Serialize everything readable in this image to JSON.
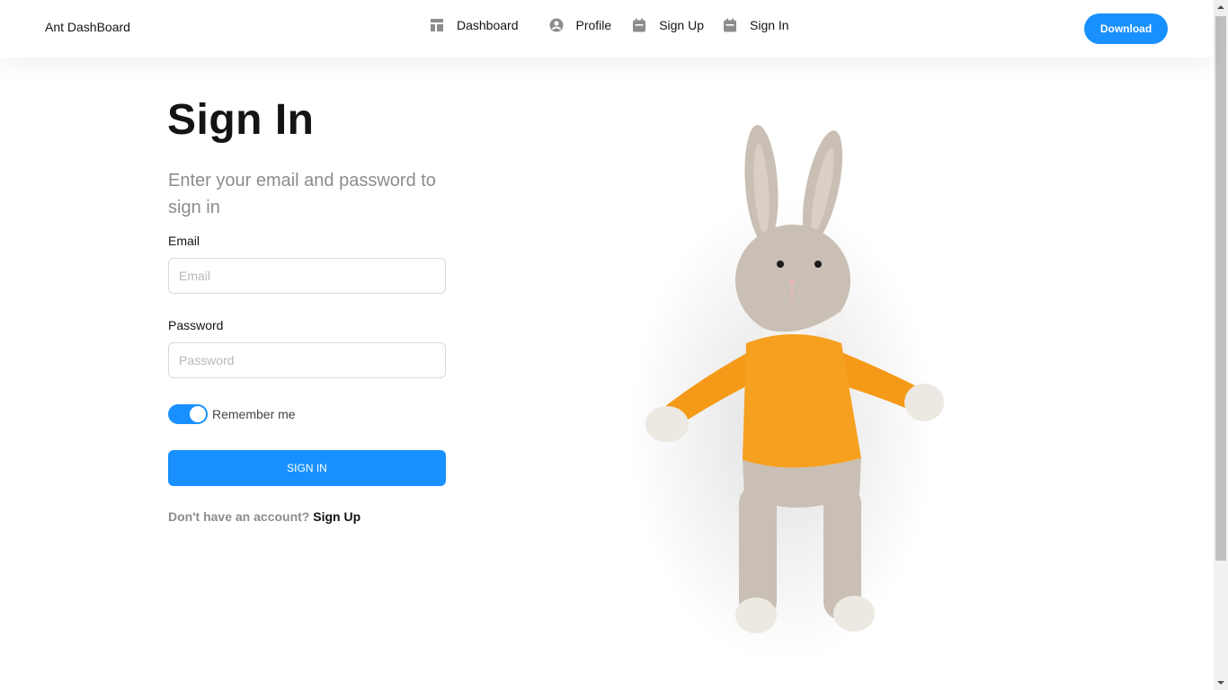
{
  "header": {
    "brand": "Ant DashBoard",
    "nav": [
      {
        "label": "Dashboard",
        "icon": "dashboard-icon"
      },
      {
        "label": "Profile",
        "icon": "user-circle-icon"
      },
      {
        "label": "Sign Up",
        "icon": "calendar-icon"
      },
      {
        "label": "Sign In",
        "icon": "calendar-icon"
      }
    ],
    "download_label": "Download"
  },
  "form": {
    "title": "Sign In",
    "subtitle": "Enter your email and password to sign in",
    "email_label": "Email",
    "email_placeholder": "Email",
    "email_value": "",
    "password_label": "Password",
    "password_placeholder": "Password",
    "password_value": "",
    "remember_label": "Remember me",
    "remember_checked": true,
    "submit_label": "SIGN IN",
    "footer_prompt": "Don't have an account?",
    "footer_link": "Sign Up"
  },
  "illustration": {
    "subject": "crocheted-bunny-toy"
  },
  "colors": {
    "primary": "#1890ff",
    "text": "#141414",
    "muted": "#8c8c8c",
    "border": "#d9d9d9"
  }
}
